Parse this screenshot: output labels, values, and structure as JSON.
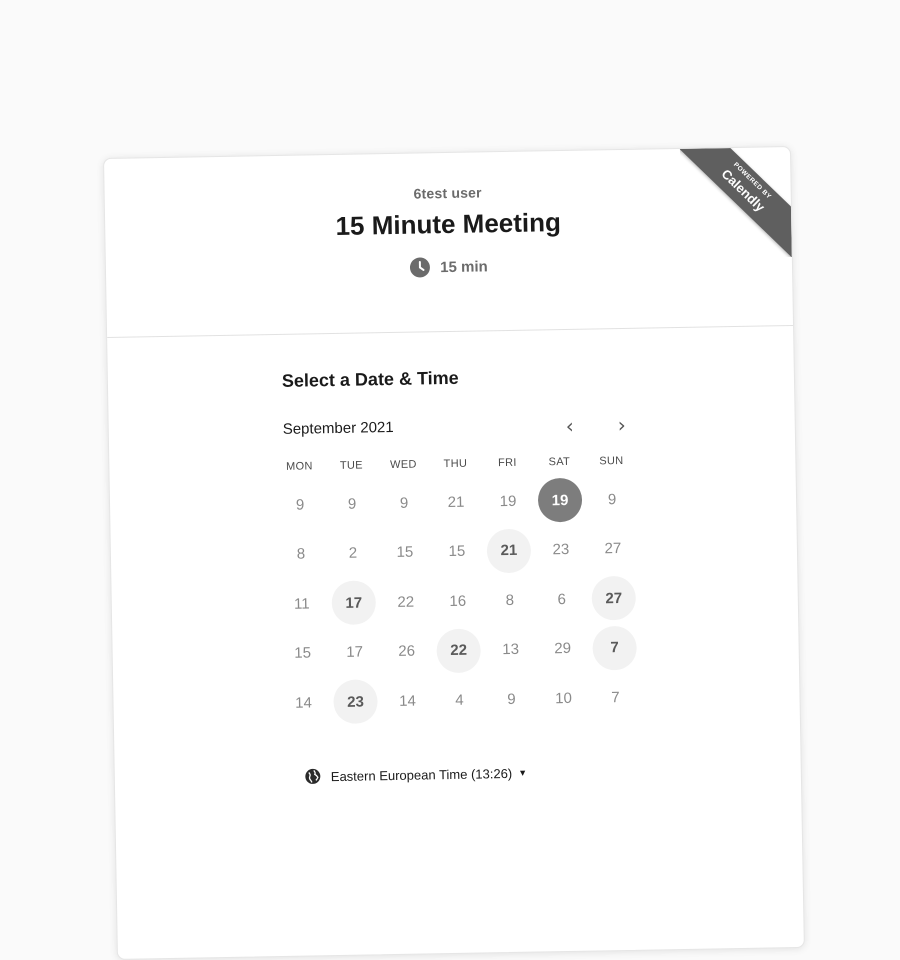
{
  "header": {
    "owner": "6test user",
    "title": "15 Minute Meeting",
    "duration": "15 min"
  },
  "ribbon": {
    "small_text": "POWERED BY",
    "brand": "Calendly"
  },
  "calendar": {
    "section_title": "Select a Date & Time",
    "month": "September 2021",
    "prev_label": "‹",
    "next_label": "›",
    "weekdays": [
      "MON",
      "TUE",
      "WED",
      "THU",
      "FRI",
      "SAT",
      "SUN"
    ],
    "weeks": [
      [
        {
          "d": "9",
          "s": "plain"
        },
        {
          "d": "9",
          "s": "plain"
        },
        {
          "d": "9",
          "s": "plain"
        },
        {
          "d": "21",
          "s": "plain"
        },
        {
          "d": "19",
          "s": "plain"
        },
        {
          "d": "19",
          "s": "selected"
        },
        {
          "d": "9",
          "s": "plain"
        }
      ],
      [
        {
          "d": "8",
          "s": "plain"
        },
        {
          "d": "2",
          "s": "plain"
        },
        {
          "d": "15",
          "s": "plain"
        },
        {
          "d": "15",
          "s": "plain"
        },
        {
          "d": "21",
          "s": "available"
        },
        {
          "d": "23",
          "s": "plain"
        },
        {
          "d": "27",
          "s": "plain"
        }
      ],
      [
        {
          "d": "11",
          "s": "plain"
        },
        {
          "d": "17",
          "s": "available"
        },
        {
          "d": "22",
          "s": "plain"
        },
        {
          "d": "16",
          "s": "plain"
        },
        {
          "d": "8",
          "s": "plain"
        },
        {
          "d": "6",
          "s": "plain"
        },
        {
          "d": "27",
          "s": "available"
        }
      ],
      [
        {
          "d": "15",
          "s": "plain"
        },
        {
          "d": "17",
          "s": "plain"
        },
        {
          "d": "26",
          "s": "plain"
        },
        {
          "d": "22",
          "s": "available"
        },
        {
          "d": "13",
          "s": "plain"
        },
        {
          "d": "29",
          "s": "plain"
        },
        {
          "d": "7",
          "s": "available"
        }
      ],
      [
        {
          "d": "14",
          "s": "plain"
        },
        {
          "d": "23",
          "s": "available"
        },
        {
          "d": "14",
          "s": "plain"
        },
        {
          "d": "4",
          "s": "plain"
        },
        {
          "d": "9",
          "s": "plain"
        },
        {
          "d": "10",
          "s": "plain"
        },
        {
          "d": "7",
          "s": "plain"
        }
      ]
    ]
  },
  "timezone": {
    "label": "Eastern European Time (13:26)"
  },
  "colors": {
    "selected_day": "#7d7d7d",
    "available_day": "#f2f2f2",
    "ribbon": "#5f5f5f"
  }
}
